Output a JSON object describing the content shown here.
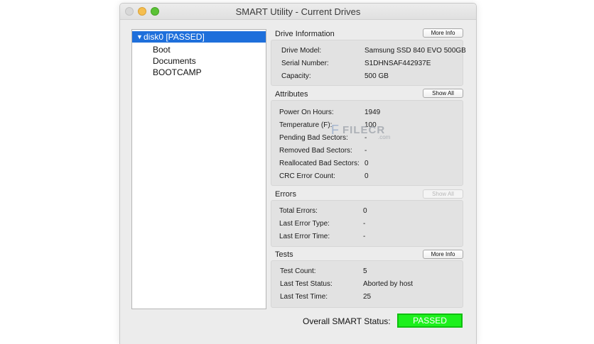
{
  "window": {
    "title": "SMART Utility - Current Drives"
  },
  "drives": {
    "selected": {
      "disclosure": "▼",
      "label": "disk0  [PASSED]"
    },
    "volumes": [
      "Boot",
      "Documents",
      "BOOTCAMP"
    ]
  },
  "drive_info": {
    "heading": "Drive Information",
    "button": "More Info",
    "fields": [
      {
        "label": "Drive Model:",
        "value": "Samsung SSD 840 EVO 500GB"
      },
      {
        "label": "Serial Number:",
        "value": "S1DHNSAF442937E"
      },
      {
        "label": "Capacity:",
        "value": "500 GB"
      }
    ]
  },
  "attributes": {
    "heading": "Attributes",
    "button": "Show All",
    "fields": [
      {
        "label": "Power On Hours:",
        "value": "1949"
      },
      {
        "label": "Temperature (F):",
        "value": "100"
      },
      {
        "label": "Pending Bad Sectors:",
        "value": "-"
      },
      {
        "label": "Removed Bad Sectors:",
        "value": "-"
      },
      {
        "label": "Reallocated Bad Sectors:",
        "value": "0"
      },
      {
        "label": "CRC Error Count:",
        "value": "0"
      }
    ]
  },
  "errors": {
    "heading": "Errors",
    "button": "Show All",
    "fields": [
      {
        "label": "Total Errors:",
        "value": "0"
      },
      {
        "label": "Last Error Type:",
        "value": "-"
      },
      {
        "label": "Last Error Time:",
        "value": "-"
      }
    ]
  },
  "tests": {
    "heading": "Tests",
    "button": "More Info",
    "fields": [
      {
        "label": "Test Count:",
        "value": "5"
      },
      {
        "label": "Last Test Status:",
        "value": "Aborted by host"
      },
      {
        "label": "Last Test Time:",
        "value": "25"
      }
    ]
  },
  "overall": {
    "label": "Overall SMART Status:",
    "status": "PASSED",
    "status_color": "#1df01d"
  },
  "watermark": {
    "logo": "F",
    "text": "FILECR",
    "sub": ".com"
  }
}
